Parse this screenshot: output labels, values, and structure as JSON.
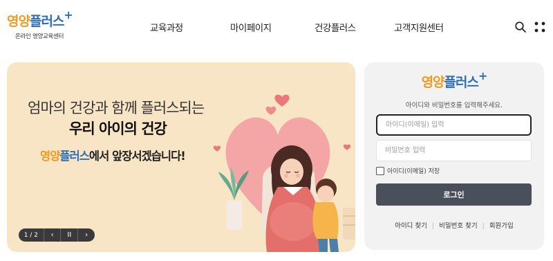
{
  "header": {
    "logo": {
      "part1": "영양",
      "part2": "플러스",
      "plus": "+",
      "subtitle": "온라인 영양교육센터"
    },
    "nav": [
      "교육과정",
      "마이페이지",
      "건강플러스",
      "고객지원센터"
    ],
    "icons": {
      "search": "search-icon",
      "menu": "grid-menu-icon"
    }
  },
  "banner": {
    "line1": "엄마의 건강과 함께 플러스되는",
    "line2": "우리 아이의 건강",
    "line3_brand1": "영양",
    "line3_brand2": "플러스",
    "line3_rest": "에서 앞장서겠습니다!",
    "slider": {
      "counter": "1 / 2",
      "prev": "‹",
      "pause": "II",
      "next": "›"
    }
  },
  "login": {
    "logo": {
      "part1": "영양",
      "part2": "플러스",
      "plus": "+"
    },
    "description": "아이디와 비밀번호를 입력해주세요.",
    "id_placeholder": "아이디(이메일) 입력",
    "pw_placeholder": "비밀번호 입력",
    "save_label": "아이디(이메일) 저장",
    "submit_label": "로그인",
    "links": [
      "아이디 찾기",
      "비밀번호 찾기",
      "회원가입"
    ]
  },
  "colors": {
    "accent_orange": "#f39a1d",
    "accent_blue": "#2c6fb7",
    "button": "#4a4f5c",
    "banner_bg": "#f8e5c6"
  }
}
